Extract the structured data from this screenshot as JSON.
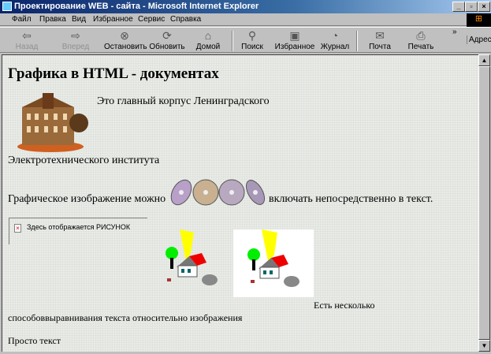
{
  "window": {
    "title": "Проектирование WEB - сайта - Microsoft Internet Explorer"
  },
  "menu": [
    "Файл",
    "Правка",
    "Вид",
    "Избранное",
    "Сервис",
    "Справка"
  ],
  "toolbar": {
    "buttons": [
      {
        "label": "Назад",
        "icon": "back-arrow-icon",
        "disabled": true
      },
      {
        "label": "Вперед",
        "icon": "forward-arrow-icon",
        "disabled": true
      },
      {
        "label": "Остановить",
        "icon": "stop-icon"
      },
      {
        "label": "Обновить",
        "icon": "refresh-icon"
      },
      {
        "label": "Домой",
        "icon": "home-icon"
      },
      {
        "label": "Поиск",
        "icon": "search-icon"
      },
      {
        "label": "Избранное",
        "icon": "favorites-icon"
      },
      {
        "label": "Журнал",
        "icon": "history-icon"
      },
      {
        "label": "Почта",
        "icon": "mail-icon"
      },
      {
        "label": "Печать",
        "icon": "print-icon"
      }
    ],
    "address_label": "Адрес",
    "more": "»"
  },
  "page": {
    "heading": "Графика в HTML - документах",
    "caption1": "Это главный корпус Ленинградского",
    "caption2": "Электротехнического института",
    "inline_text_before": "Графическое изображение можно",
    "inline_text_after": "включать непосредственно в текст.",
    "broken_image_alt": "Здесь отображается РИСУНОК",
    "align_text1": "Есть несколько",
    "align_text2": "способоввыравнивания текста относительно изображения",
    "plain_text": "Просто текст"
  }
}
